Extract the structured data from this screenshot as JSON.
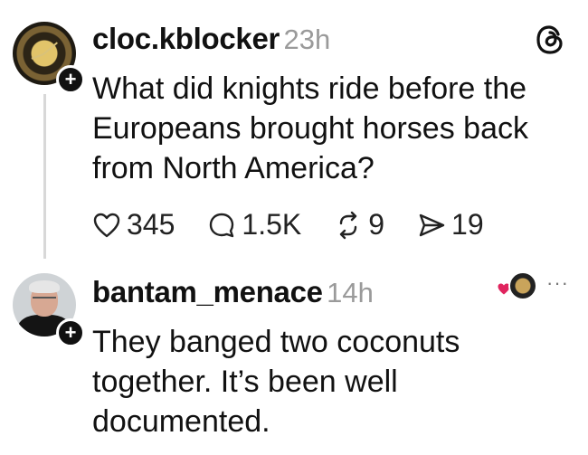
{
  "post": {
    "username": "cloc.kblocker",
    "time": "23h",
    "text_lines": [
      "What did knights ride before the",
      "Europeans brought horses back",
      "from North America?"
    ],
    "actions": {
      "likes": "345",
      "replies": "1.5K",
      "reposts": "9",
      "shares": "19"
    },
    "brand_icon": "threads-icon"
  },
  "reply": {
    "username": "bantam_menace",
    "time": "14h",
    "text_lines": [
      "They banged two coconuts",
      "together. It’s been well",
      "documented."
    ],
    "more_label": "···"
  },
  "colors": {
    "text": "#111111",
    "muted": "#9a9a9a",
    "thread_line": "#d8d8d8",
    "like_heart": "#e0245e"
  }
}
